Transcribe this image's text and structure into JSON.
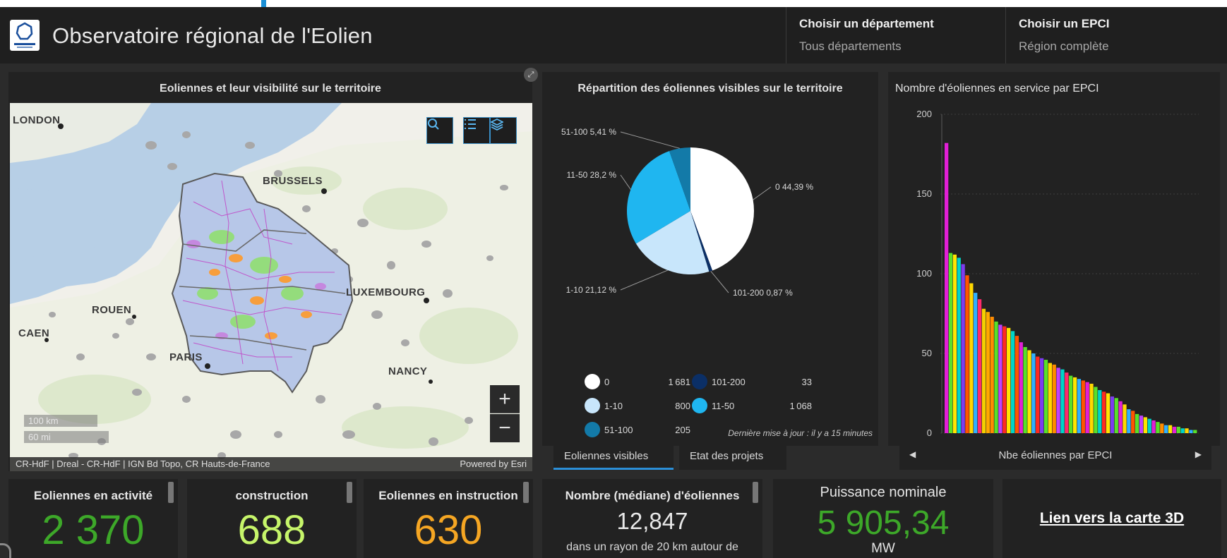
{
  "header": {
    "title": "Observatoire régional de l'Eolien",
    "selector_department": {
      "label": "Choisir un département",
      "value": "Tous départements"
    },
    "selector_epci": {
      "label": "Choisir un EPCI",
      "value": "Région complète"
    }
  },
  "map": {
    "title": "Eoliennes et leur visibilité sur le territoire",
    "cities": [
      "LONDON",
      "BRUSSELS",
      "LUXEMBOURG",
      "ROUEN",
      "CAEN",
      "PARIS",
      "NANCY"
    ],
    "scale_km": "100 km",
    "scale_mi": "60 mi",
    "attribution_left": "CR-HdF | Dreal - CR-HdF | IGN Bd Topo, CR Hauts-de-France",
    "attribution_right": "Powered by Esri",
    "zoom_in_label": "+",
    "zoom_out_label": "−"
  },
  "pie": {
    "title": "Répartition des éoliennes visibles sur le territoire",
    "footer": "Dernière mise à jour : il y a 15 minutes",
    "tabs": [
      "Eoliennes visibles",
      "Etat des projets"
    ]
  },
  "chart_data": [
    {
      "type": "pie",
      "title": "Répartition des éoliennes visibles sur le territoire",
      "slices": [
        {
          "label": "0",
          "count": 1681,
          "pct_label": "0 44,39 %",
          "percent": 44.39,
          "color": "#ffffff"
        },
        {
          "label": "101-200",
          "count": 33,
          "pct_label": "101-200 0,87 %",
          "percent": 0.87,
          "color": "#0b2f66"
        },
        {
          "label": "1-10",
          "count": 800,
          "pct_label": "1-10 21,12 %",
          "percent": 21.12,
          "color": "#c8e6fb"
        },
        {
          "label": "11-50",
          "count": 1068,
          "pct_label": "11-50 28,2 %",
          "percent": 28.2,
          "color": "#1fb6f0"
        },
        {
          "label": "51-100",
          "count": 205,
          "pct_label": "51-100 5,41 %",
          "percent": 5.41,
          "color": "#137aa8"
        }
      ],
      "legend_placement": "bottom"
    },
    {
      "type": "bar",
      "title": "Nombre d'éoliennes en service par EPCI",
      "xlabel": "Nbe éoliennes par EPCI",
      "ylabel": "",
      "ylim": [
        0,
        200
      ],
      "yticks": [
        0,
        50,
        100,
        150,
        200
      ],
      "grid": true,
      "values": [
        182,
        113,
        112,
        110,
        106,
        99,
        94,
        88,
        84,
        78,
        76,
        73,
        70,
        68,
        67,
        66,
        64,
        61,
        57,
        54,
        52,
        50,
        48,
        47,
        46,
        44,
        43,
        41,
        40,
        38,
        36,
        35,
        34,
        33,
        32,
        31,
        29,
        27,
        26,
        25,
        23,
        22,
        20,
        18,
        15,
        14,
        12,
        11,
        10,
        9,
        8,
        7,
        6,
        5,
        5,
        4,
        4,
        3,
        3,
        2,
        2
      ],
      "colors": [
        "#e21fd6",
        "#58e02a",
        "#ffe500",
        "#00d4c8",
        "#7c3cf0",
        "#ff5500",
        "#ffd800",
        "#2fb0ff",
        "#ff2a6a",
        "#f4d000",
        "#ffa800",
        "#ff8c00",
        "#58e02a",
        "#c040ff",
        "#ff2a20",
        "#ffe500",
        "#00d4c8",
        "#ff5500",
        "#e21fd6",
        "#58e02a",
        "#ffe500",
        "#2fb0ff",
        "#ff2a20",
        "#7c3cf0",
        "#58e02a",
        "#ffd800",
        "#ff8c00",
        "#c040ff",
        "#00d4c8",
        "#ff2a6a",
        "#58e02a",
        "#ffe500",
        "#2fb0ff",
        "#ff5500",
        "#e21fd6",
        "#ffd800",
        "#58e02a",
        "#00d4c8",
        "#ff2a20",
        "#ffe500",
        "#7c3cf0",
        "#58e02a",
        "#e21fd6",
        "#ffd800",
        "#2fb0ff",
        "#ff5500",
        "#58e02a",
        "#c040ff",
        "#ffe500",
        "#00d4c8",
        "#e21fd6",
        "#58e02a",
        "#ff8c00",
        "#2fb0ff",
        "#ffe500",
        "#e21fd6",
        "#58e02a",
        "#00d4c8",
        "#ffd800",
        "#2fb0ff",
        "#58e02a"
      ]
    }
  ],
  "bar_nav": {
    "label": "Nbe éoliennes par EPCI",
    "prev_icon": "◀",
    "next_icon": "▶"
  },
  "kpis": {
    "activite": {
      "label": "Eoliennes en activité",
      "value": "2 370",
      "color": "#3da829"
    },
    "construction": {
      "label": "construction",
      "value": "688",
      "color": "#c6f56a"
    },
    "instruction": {
      "label": "Eoliennes en instruction",
      "value": "630",
      "color": "#f5a623"
    },
    "mediane": {
      "label": "Nombre (médiane) d'éoliennes",
      "value": "12,847",
      "sub": "dans un rayon de 20 km autour de"
    },
    "puissance": {
      "label": "Puissance nominale",
      "value": "5 905,34",
      "unit": "MW",
      "color": "#3da829"
    },
    "lien": {
      "label": "Lien vers la carte 3D"
    }
  },
  "icons": {
    "search": "search-icon",
    "legend": "list-icon",
    "layers": "layers-icon",
    "expand": "expand-icon"
  },
  "colors": {
    "accent": "#2b8fd8",
    "panel": "#222222",
    "background": "#2b2b2b"
  }
}
